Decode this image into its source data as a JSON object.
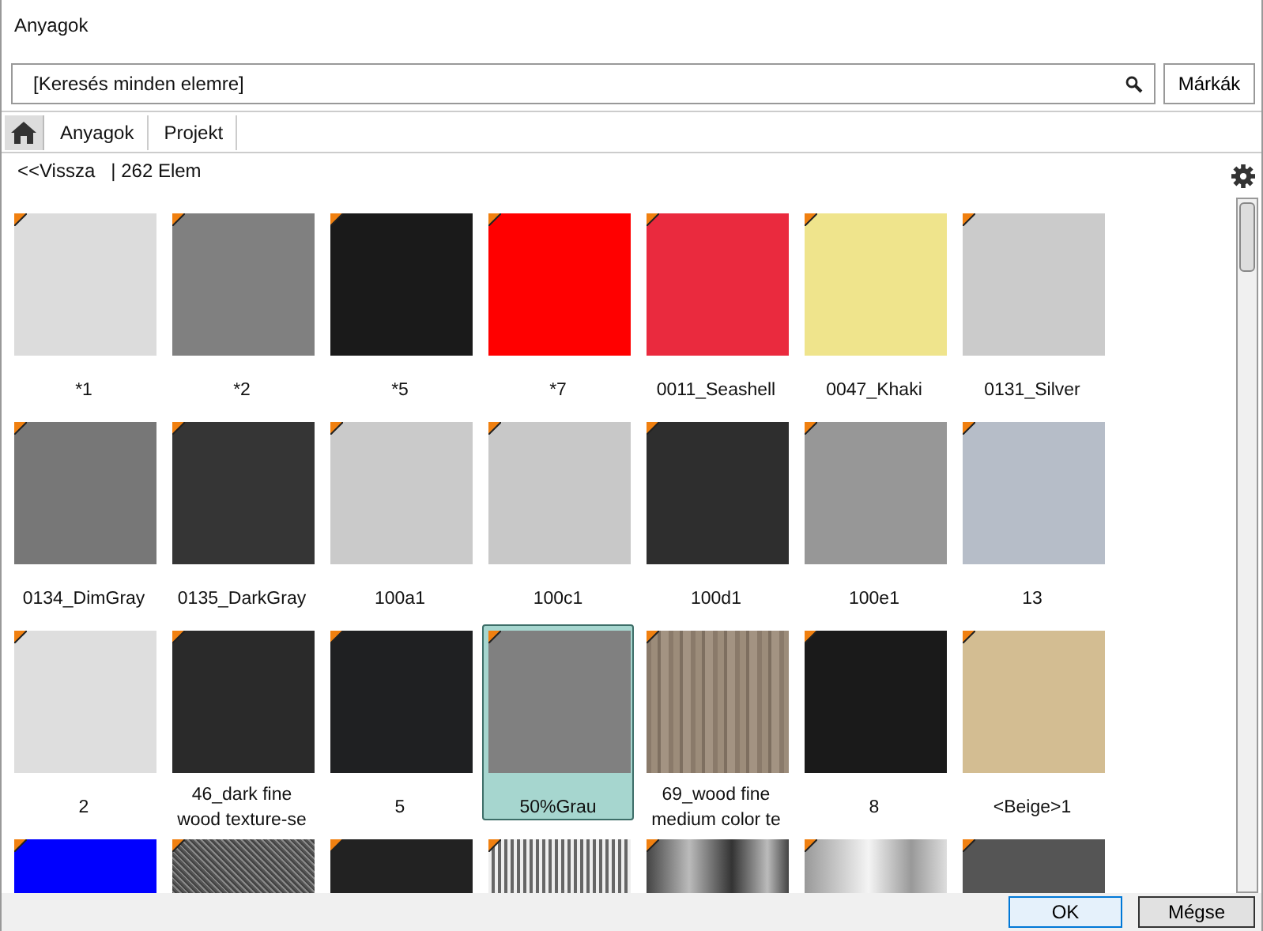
{
  "window": {
    "title": "Anyagok"
  },
  "search": {
    "placeholder": "[Keresés minden elemre]"
  },
  "brands_button": "Márkák",
  "breadcrumb": [
    "Anyagok",
    "Projekt"
  ],
  "toolbar": {
    "back": "<<Vissza",
    "count": "| 262 Elem"
  },
  "materials": [
    {
      "label": "*1",
      "kind": "color",
      "color": "#dcdcdc",
      "selected": false
    },
    {
      "label": "*2",
      "kind": "color",
      "color": "#808080",
      "selected": false
    },
    {
      "label": "*5",
      "kind": "color",
      "color": "#1a1a1a",
      "selected": false
    },
    {
      "label": "*7",
      "kind": "color",
      "color": "#ff0000",
      "selected": false
    },
    {
      "label": "0011_Seashell",
      "kind": "color",
      "color": "#ea2a3e",
      "selected": false
    },
    {
      "label": "0047_Khaki",
      "kind": "color",
      "color": "#efe48c",
      "selected": false
    },
    {
      "label": "0131_Silver",
      "kind": "color",
      "color": "#cbcbcb",
      "selected": false
    },
    {
      "label": "0134_DimGray",
      "kind": "color",
      "color": "#777777",
      "selected": false
    },
    {
      "label": "0135_DarkGray",
      "kind": "color",
      "color": "#353535",
      "selected": false
    },
    {
      "label": "100a1",
      "kind": "color",
      "color": "#cacaca",
      "selected": false
    },
    {
      "label": "100c1",
      "kind": "color",
      "color": "#c8c8c8",
      "selected": false
    },
    {
      "label": "100d1",
      "kind": "color",
      "color": "#2e2e2e",
      "selected": false
    },
    {
      "label": "100e1",
      "kind": "color",
      "color": "#979797",
      "selected": false
    },
    {
      "label": "13",
      "kind": "color",
      "color": "#b6bdc8",
      "selected": false
    },
    {
      "label": "2",
      "kind": "color",
      "color": "#dedede",
      "selected": false
    },
    {
      "label": "46_dark fine wood  texture-se",
      "kind": "color",
      "color": "#2a2a2a",
      "selected": false
    },
    {
      "label": "5",
      "kind": "color",
      "color": "#1f2022",
      "selected": false
    },
    {
      "label": "50%Grau",
      "kind": "color",
      "color": "#808080",
      "selected": true
    },
    {
      "label": "69_wood fine medium  color te",
      "kind": "wood",
      "selected": false
    },
    {
      "label": "8",
      "kind": "color",
      "color": "#1a1a1a",
      "selected": false
    },
    {
      "label": "<Beige>1",
      "kind": "color",
      "color": "#d3bd92",
      "selected": false
    },
    {
      "kind": "color",
      "color": "#0000ff",
      "selected": false
    },
    {
      "kind": "noise",
      "selected": false
    },
    {
      "kind": "color",
      "color": "#222222",
      "selected": false
    },
    {
      "kind": "stripes",
      "selected": false
    },
    {
      "kind": "dark-gradient",
      "selected": false
    },
    {
      "kind": "light-gradient",
      "selected": false
    },
    {
      "kind": "color",
      "color": "#555555",
      "selected": false
    }
  ],
  "buttons": [
    "OK",
    "Mégse"
  ]
}
